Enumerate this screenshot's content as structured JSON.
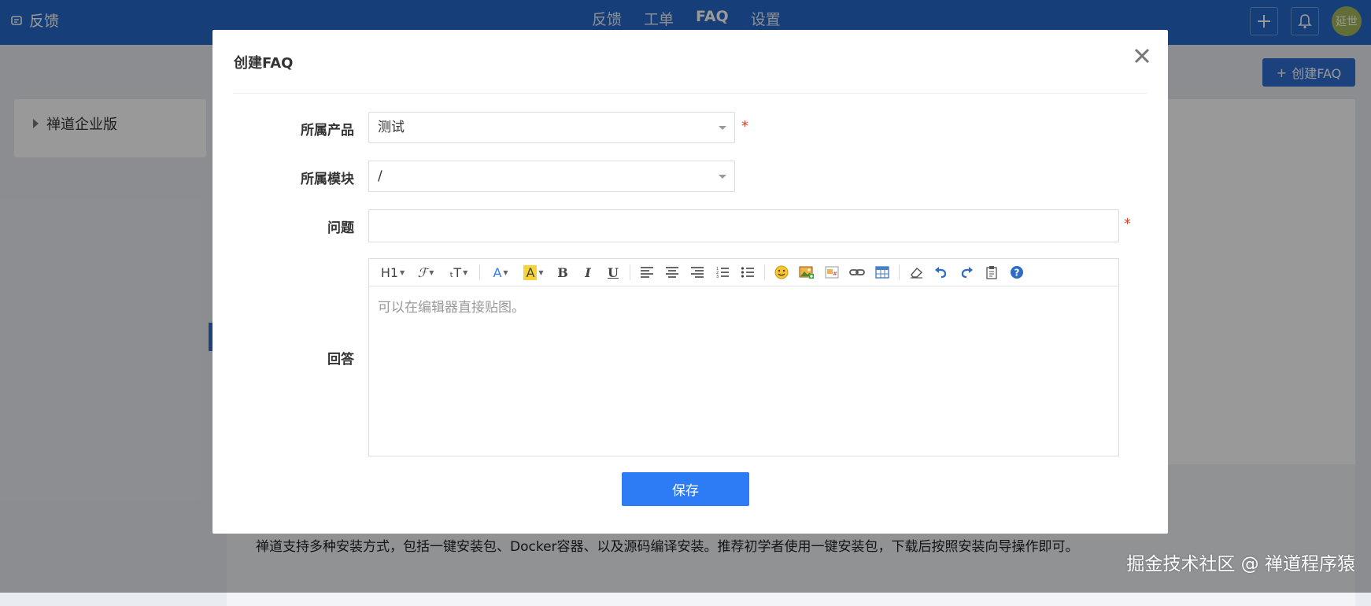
{
  "topbar": {
    "brand_label": "反馈",
    "nav": [
      "反馈",
      "工单",
      "FAQ",
      "设置"
    ],
    "active_nav": "FAQ",
    "avatar_text": "延世"
  },
  "background": {
    "create_faq_label": "创建FAQ",
    "tree_item": "禅道企业版",
    "answer_preview": "禅道支持多种安装方式，包括一键安装包、Docker容器、以及源码编译安装。推荐初学者使用一键安装包，下载后按照安装向导操作即可。"
  },
  "modal": {
    "title": "创建FAQ",
    "product_label": "所属产品",
    "product_value": "测试",
    "module_label": "所属模块",
    "module_value": "/",
    "question_label": "问题",
    "question_value": "",
    "answer_label": "回答",
    "answer_placeholder": "可以在编辑器直接贴图。",
    "required_mark": "*",
    "save_label": "保存"
  },
  "editor_toolbar": {
    "heading": "H1",
    "font_family": "ℱ",
    "font_size": "ₜT",
    "font_color": "A",
    "bg_color": "A",
    "bold": "B",
    "italic": "I",
    "underline": "U"
  },
  "watermark": "掘金技术社区 @ 禅道程序猿",
  "colors": {
    "topbar": "#2668c8",
    "primary": "#2d7cf6",
    "required": "#e5412a",
    "highlight": "#f7d33a"
  }
}
